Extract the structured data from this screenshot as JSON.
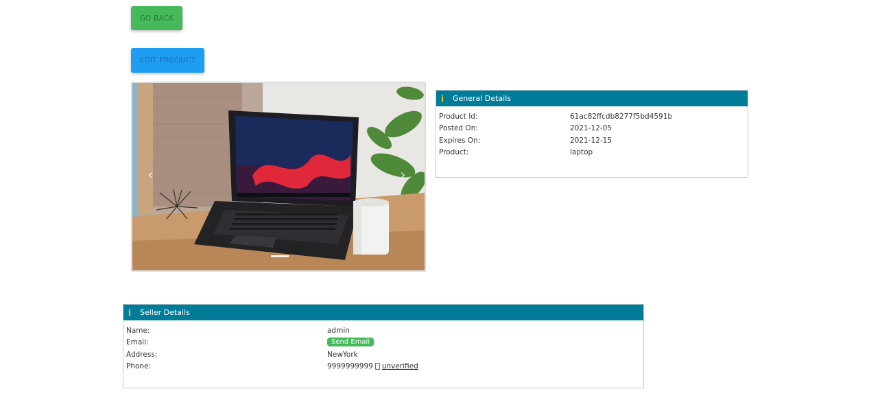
{
  "actions": {
    "go_back_label": "GO BACK",
    "edit_product_label": "EDIT PRODUCT"
  },
  "carousel": {
    "image": "laptop-photo",
    "prev_icon": "chevron-left-icon",
    "next_icon": "chevron-right-icon",
    "slide_count": 1,
    "active_slide": 1
  },
  "general_details": {
    "title": "General Details",
    "icon": "info-icon",
    "rows": [
      {
        "label": "Product Id:",
        "value": "61ac82ffcdb8277f5bd4591b"
      },
      {
        "label": "Posted On:",
        "value": "2021-12-05"
      },
      {
        "label": "Expires On:",
        "value": "2021-12-15"
      },
      {
        "label": "Product:",
        "value": "laptop"
      }
    ]
  },
  "seller_details": {
    "title": "Seller Details",
    "icon": "info-icon",
    "name_label": "Name:",
    "name_value": "admin",
    "email_label": "Email:",
    "email_button": "Send Email",
    "address_label": "Address:",
    "address_value": "NewYork",
    "phone_label": "Phone:",
    "phone_value": "9999999999",
    "phone_icon": "mobile-phone-icon",
    "phone_status": "unverified"
  },
  "colors": {
    "header_bg": "#007c99",
    "go_back_bg": "#46b95b",
    "edit_bg": "#1e9df2",
    "info_icon": "#f0c419"
  }
}
